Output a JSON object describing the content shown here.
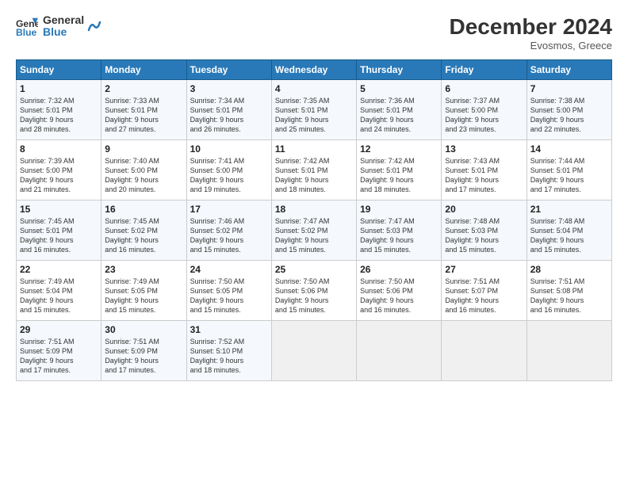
{
  "header": {
    "logo_line1": "General",
    "logo_line2": "Blue",
    "month_year": "December 2024",
    "location": "Evosmos, Greece"
  },
  "days_of_week": [
    "Sunday",
    "Monday",
    "Tuesday",
    "Wednesday",
    "Thursday",
    "Friday",
    "Saturday"
  ],
  "weeks": [
    [
      {
        "day": "1",
        "lines": [
          "Sunrise: 7:32 AM",
          "Sunset: 5:01 PM",
          "Daylight: 9 hours",
          "and 28 minutes."
        ]
      },
      {
        "day": "2",
        "lines": [
          "Sunrise: 7:33 AM",
          "Sunset: 5:01 PM",
          "Daylight: 9 hours",
          "and 27 minutes."
        ]
      },
      {
        "day": "3",
        "lines": [
          "Sunrise: 7:34 AM",
          "Sunset: 5:01 PM",
          "Daylight: 9 hours",
          "and 26 minutes."
        ]
      },
      {
        "day": "4",
        "lines": [
          "Sunrise: 7:35 AM",
          "Sunset: 5:01 PM",
          "Daylight: 9 hours",
          "and 25 minutes."
        ]
      },
      {
        "day": "5",
        "lines": [
          "Sunrise: 7:36 AM",
          "Sunset: 5:01 PM",
          "Daylight: 9 hours",
          "and 24 minutes."
        ]
      },
      {
        "day": "6",
        "lines": [
          "Sunrise: 7:37 AM",
          "Sunset: 5:00 PM",
          "Daylight: 9 hours",
          "and 23 minutes."
        ]
      },
      {
        "day": "7",
        "lines": [
          "Sunrise: 7:38 AM",
          "Sunset: 5:00 PM",
          "Daylight: 9 hours",
          "and 22 minutes."
        ]
      }
    ],
    [
      {
        "day": "8",
        "lines": [
          "Sunrise: 7:39 AM",
          "Sunset: 5:00 PM",
          "Daylight: 9 hours",
          "and 21 minutes."
        ]
      },
      {
        "day": "9",
        "lines": [
          "Sunrise: 7:40 AM",
          "Sunset: 5:00 PM",
          "Daylight: 9 hours",
          "and 20 minutes."
        ]
      },
      {
        "day": "10",
        "lines": [
          "Sunrise: 7:41 AM",
          "Sunset: 5:00 PM",
          "Daylight: 9 hours",
          "and 19 minutes."
        ]
      },
      {
        "day": "11",
        "lines": [
          "Sunrise: 7:42 AM",
          "Sunset: 5:01 PM",
          "Daylight: 9 hours",
          "and 18 minutes."
        ]
      },
      {
        "day": "12",
        "lines": [
          "Sunrise: 7:42 AM",
          "Sunset: 5:01 PM",
          "Daylight: 9 hours",
          "and 18 minutes."
        ]
      },
      {
        "day": "13",
        "lines": [
          "Sunrise: 7:43 AM",
          "Sunset: 5:01 PM",
          "Daylight: 9 hours",
          "and 17 minutes."
        ]
      },
      {
        "day": "14",
        "lines": [
          "Sunrise: 7:44 AM",
          "Sunset: 5:01 PM",
          "Daylight: 9 hours",
          "and 17 minutes."
        ]
      }
    ],
    [
      {
        "day": "15",
        "lines": [
          "Sunrise: 7:45 AM",
          "Sunset: 5:01 PM",
          "Daylight: 9 hours",
          "and 16 minutes."
        ]
      },
      {
        "day": "16",
        "lines": [
          "Sunrise: 7:45 AM",
          "Sunset: 5:02 PM",
          "Daylight: 9 hours",
          "and 16 minutes."
        ]
      },
      {
        "day": "17",
        "lines": [
          "Sunrise: 7:46 AM",
          "Sunset: 5:02 PM",
          "Daylight: 9 hours",
          "and 15 minutes."
        ]
      },
      {
        "day": "18",
        "lines": [
          "Sunrise: 7:47 AM",
          "Sunset: 5:02 PM",
          "Daylight: 9 hours",
          "and 15 minutes."
        ]
      },
      {
        "day": "19",
        "lines": [
          "Sunrise: 7:47 AM",
          "Sunset: 5:03 PM",
          "Daylight: 9 hours",
          "and 15 minutes."
        ]
      },
      {
        "day": "20",
        "lines": [
          "Sunrise: 7:48 AM",
          "Sunset: 5:03 PM",
          "Daylight: 9 hours",
          "and 15 minutes."
        ]
      },
      {
        "day": "21",
        "lines": [
          "Sunrise: 7:48 AM",
          "Sunset: 5:04 PM",
          "Daylight: 9 hours",
          "and 15 minutes."
        ]
      }
    ],
    [
      {
        "day": "22",
        "lines": [
          "Sunrise: 7:49 AM",
          "Sunset: 5:04 PM",
          "Daylight: 9 hours",
          "and 15 minutes."
        ]
      },
      {
        "day": "23",
        "lines": [
          "Sunrise: 7:49 AM",
          "Sunset: 5:05 PM",
          "Daylight: 9 hours",
          "and 15 minutes."
        ]
      },
      {
        "day": "24",
        "lines": [
          "Sunrise: 7:50 AM",
          "Sunset: 5:05 PM",
          "Daylight: 9 hours",
          "and 15 minutes."
        ]
      },
      {
        "day": "25",
        "lines": [
          "Sunrise: 7:50 AM",
          "Sunset: 5:06 PM",
          "Daylight: 9 hours",
          "and 15 minutes."
        ]
      },
      {
        "day": "26",
        "lines": [
          "Sunrise: 7:50 AM",
          "Sunset: 5:06 PM",
          "Daylight: 9 hours",
          "and 16 minutes."
        ]
      },
      {
        "day": "27",
        "lines": [
          "Sunrise: 7:51 AM",
          "Sunset: 5:07 PM",
          "Daylight: 9 hours",
          "and 16 minutes."
        ]
      },
      {
        "day": "28",
        "lines": [
          "Sunrise: 7:51 AM",
          "Sunset: 5:08 PM",
          "Daylight: 9 hours",
          "and 16 minutes."
        ]
      }
    ],
    [
      {
        "day": "29",
        "lines": [
          "Sunrise: 7:51 AM",
          "Sunset: 5:09 PM",
          "Daylight: 9 hours",
          "and 17 minutes."
        ]
      },
      {
        "day": "30",
        "lines": [
          "Sunrise: 7:51 AM",
          "Sunset: 5:09 PM",
          "Daylight: 9 hours",
          "and 17 minutes."
        ]
      },
      {
        "day": "31",
        "lines": [
          "Sunrise: 7:52 AM",
          "Sunset: 5:10 PM",
          "Daylight: 9 hours",
          "and 18 minutes."
        ]
      },
      {
        "day": "",
        "lines": []
      },
      {
        "day": "",
        "lines": []
      },
      {
        "day": "",
        "lines": []
      },
      {
        "day": "",
        "lines": []
      }
    ]
  ]
}
